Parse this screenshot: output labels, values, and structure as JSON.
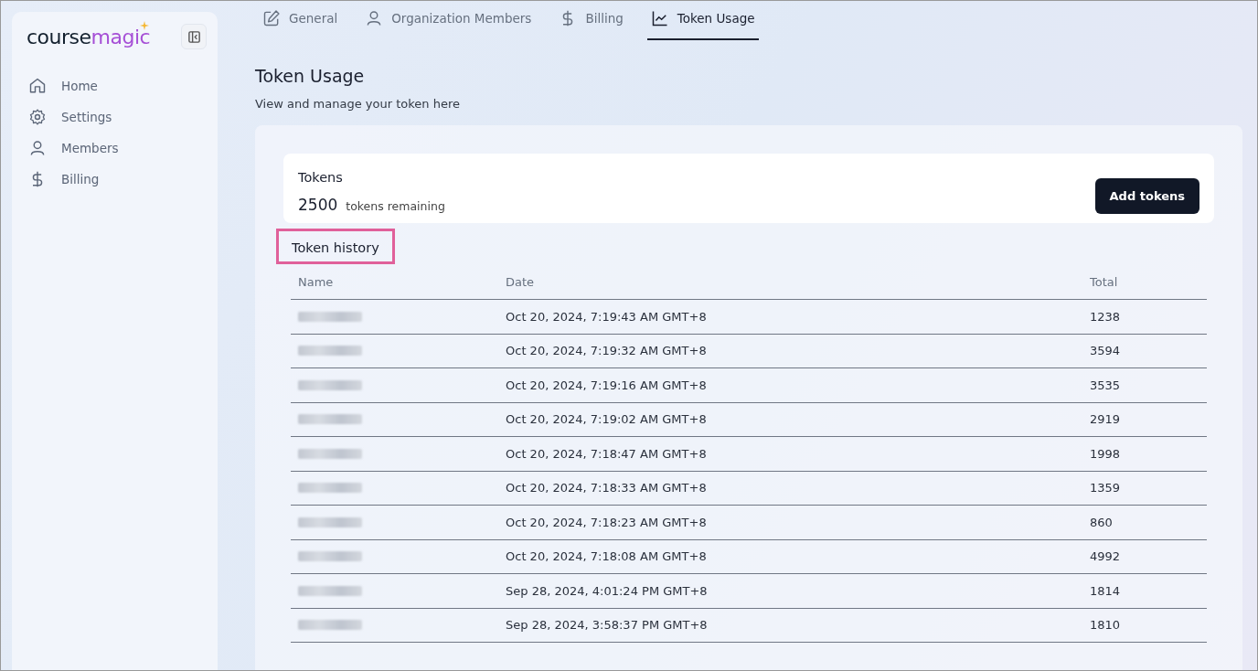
{
  "sidebar": {
    "logo": {
      "part_1": "course",
      "part_2": "magic"
    },
    "items": [
      {
        "label": "Home",
        "kind": "home",
        "selected": false
      },
      {
        "label": "Settings",
        "kind": "gear",
        "selected": false
      },
      {
        "label": "Members",
        "kind": "user",
        "selected": false
      },
      {
        "label": "Billing",
        "kind": "dollar",
        "selected": false
      }
    ]
  },
  "tabs": [
    {
      "label": "General",
      "kind": "edit",
      "selected": false
    },
    {
      "label": "Organization Members",
      "kind": "user",
      "selected": false
    },
    {
      "label": "Billing",
      "kind": "dollar",
      "selected": false
    },
    {
      "label": "Token Usage",
      "kind": "chart",
      "selected": true
    }
  ],
  "page": {
    "title": "Token Usage",
    "subtitle": "View and manage your token here"
  },
  "tokens_card": {
    "title": "Tokens",
    "count": "2500",
    "count_label": "tokens remaining",
    "button": "Add tokens"
  },
  "history": {
    "title": "Token history",
    "highlighted": true,
    "columns": [
      "Name",
      "Date",
      "Total"
    ],
    "rows": [
      {
        "date": "Oct 20, 2024, 7:19:43 AM GMT+8",
        "total": "1238"
      },
      {
        "date": "Oct 20, 2024, 7:19:32 AM GMT+8",
        "total": "3594"
      },
      {
        "date": "Oct 20, 2024, 7:19:16 AM GMT+8",
        "total": "3535"
      },
      {
        "date": "Oct 20, 2024, 7:19:02 AM GMT+8",
        "total": "2919"
      },
      {
        "date": "Oct 20, 2024, 7:18:47 AM GMT+8",
        "total": "1998"
      },
      {
        "date": "Oct 20, 2024, 7:18:33 AM GMT+8",
        "total": "1359"
      },
      {
        "date": "Oct 20, 2024, 7:18:23 AM GMT+8",
        "total": "860"
      },
      {
        "date": "Oct 20, 2024, 7:18:08 AM GMT+8",
        "total": "4992"
      },
      {
        "date": "Sep 28, 2024, 4:01:24 PM GMT+8",
        "total": "1814"
      },
      {
        "date": "Sep 28, 2024, 3:58:37 PM GMT+8",
        "total": "1810"
      }
    ]
  }
}
